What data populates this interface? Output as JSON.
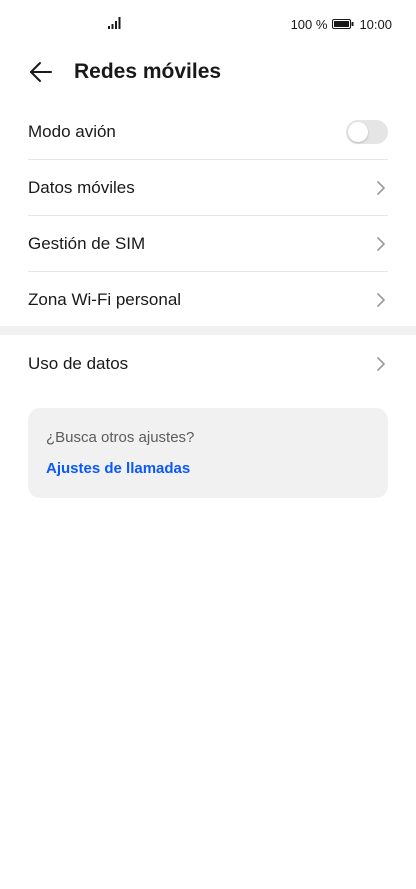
{
  "status_bar": {
    "battery_percent": "100 %",
    "time": "10:00",
    "signal_icon": "signal-bars-icon",
    "battery_icon": "battery-full-icon"
  },
  "header": {
    "back_icon": "arrow-left-icon",
    "title": "Redes móviles"
  },
  "list": {
    "items": [
      {
        "label": "Modo avión",
        "control": "toggle",
        "toggle_on": false
      },
      {
        "label": "Datos móviles",
        "control": "chevron"
      },
      {
        "label": "Gestión de SIM",
        "control": "chevron"
      },
      {
        "label": "Zona Wi-Fi personal",
        "control": "chevron"
      }
    ],
    "secondary_items": [
      {
        "label": "Uso de datos",
        "control": "chevron"
      }
    ]
  },
  "suggestion": {
    "question": "¿Busca otros ajustes?",
    "link_label": "Ajustes de llamadas"
  },
  "colors": {
    "link": "#0a59f7",
    "text_primary": "#191919",
    "card_background": "#f1f1f1",
    "toggle_off": "#e5e5e5"
  }
}
